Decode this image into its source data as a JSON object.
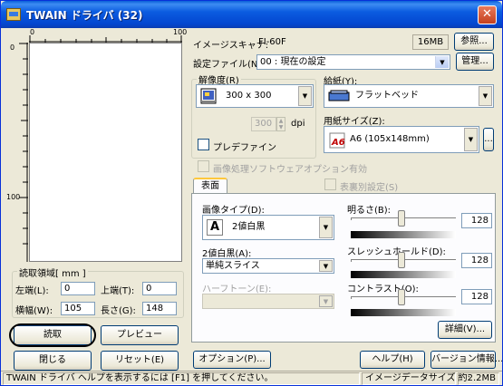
{
  "window": {
    "title": "TWAIN ドライバ (32)",
    "close_label": "✕"
  },
  "preview": {
    "ruler_top_start": "0",
    "ruler_top_end": "100",
    "ruler_left_start": "0",
    "ruler_left_mid": "100"
  },
  "scanner": {
    "label": "イメージスキャナ:",
    "value": "FI-60F",
    "memory": "16MB",
    "browse_label": "参照..."
  },
  "settings_file": {
    "label": "設定ファイル(N):",
    "value": "00 : 現在の設定",
    "manage_label": "管理..."
  },
  "resolution": {
    "group_label": "解像度(R)",
    "value": "300 x 300",
    "custom_value": "300",
    "unit": "dpi",
    "prefine_label": "プレデファイン"
  },
  "paper_feed": {
    "group_label": "給紙(Y):",
    "value": "フラットベッド"
  },
  "paper_size": {
    "label": "用紙サイズ(Z):",
    "value": "A6 (105x148mm)",
    "more_label": "..."
  },
  "image_processing": {
    "label": "画像処理ソフトウェアオプション有効"
  },
  "tabs": {
    "front_label": "表面",
    "separate_label": "表裏別設定(S)"
  },
  "image_type": {
    "label": "画像タイプ(D):",
    "value": "2値白黒",
    "icon_letter": "A"
  },
  "binary": {
    "label": "2値白黒(A):",
    "value": "単純スライス"
  },
  "halftone": {
    "label": "ハーフトーン(E):",
    "value": ""
  },
  "brightness": {
    "label": "明るさ(B):",
    "value": "128"
  },
  "threshold": {
    "label": "スレッシュホールド(D):",
    "value": "128"
  },
  "contrast": {
    "label": "コントラスト(O):",
    "value": "128"
  },
  "detail_label": "詳細(V)...",
  "read_area": {
    "group_label": "読取領域[ mm ]",
    "left_label": "左端(L):",
    "left_value": "0",
    "top_label": "上端(T):",
    "top_value": "0",
    "width_label": "横幅(W):",
    "width_value": "105",
    "length_label": "長さ(G):",
    "length_value": "148"
  },
  "buttons": {
    "scan": "読取",
    "preview": "プレビュー",
    "close": "閉じる",
    "reset": "リセット(E)",
    "options": "オプション(P)...",
    "help": "ヘルプ(H)",
    "version": "バージョン情報..."
  },
  "status": {
    "message": "TWAIN ドライバ ヘルプを表示するには [F1] を押してください。",
    "data_size_label": "イメージデータサイズ 約:",
    "data_size_value": "2.2MB"
  }
}
